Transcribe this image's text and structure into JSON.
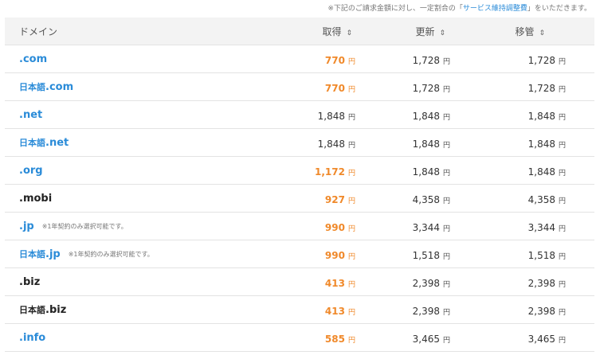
{
  "notice": {
    "before": "※下記のご請求金額に対し、一定割合の「",
    "link": "サービス維持調整費",
    "after": "」をいただきます。"
  },
  "header": {
    "domain": "ドメイン",
    "acquire": "取得",
    "renew": "更新",
    "transfer": "移管",
    "sort_icon": "⇕"
  },
  "currency": "円",
  "rows": [
    {
      "jp": "",
      "ext": ".com",
      "note": "",
      "color": "blue",
      "acquire": "770",
      "acquire_highlight": true,
      "renew": "1,728",
      "transfer": "1,728"
    },
    {
      "jp": "日本語",
      "ext": ".com",
      "note": "",
      "color": "blue",
      "acquire": "770",
      "acquire_highlight": true,
      "renew": "1,728",
      "transfer": "1,728"
    },
    {
      "jp": "",
      "ext": ".net",
      "note": "",
      "color": "blue",
      "acquire": "1,848",
      "acquire_highlight": false,
      "renew": "1,848",
      "transfer": "1,848"
    },
    {
      "jp": "日本語",
      "ext": ".net",
      "note": "",
      "color": "blue",
      "acquire": "1,848",
      "acquire_highlight": false,
      "renew": "1,848",
      "transfer": "1,848"
    },
    {
      "jp": "",
      "ext": ".org",
      "note": "",
      "color": "blue",
      "acquire": "1,172",
      "acquire_highlight": true,
      "renew": "1,848",
      "transfer": "1,848"
    },
    {
      "jp": "",
      "ext": ".mobi",
      "note": "",
      "color": "black",
      "acquire": "927",
      "acquire_highlight": true,
      "renew": "4,358",
      "transfer": "4,358"
    },
    {
      "jp": "",
      "ext": ".jp",
      "note": "※1年契約のみ選択可能です。",
      "color": "blue",
      "acquire": "990",
      "acquire_highlight": true,
      "renew": "3,344",
      "transfer": "3,344"
    },
    {
      "jp": "日本語",
      "ext": ".jp",
      "note": "※1年契約のみ選択可能です。",
      "color": "blue",
      "acquire": "990",
      "acquire_highlight": true,
      "renew": "1,518",
      "transfer": "1,518"
    },
    {
      "jp": "",
      "ext": ".biz",
      "note": "",
      "color": "black",
      "acquire": "413",
      "acquire_highlight": true,
      "renew": "2,398",
      "transfer": "2,398"
    },
    {
      "jp": "日本語",
      "ext": ".biz",
      "note": "",
      "color": "black",
      "acquire": "413",
      "acquire_highlight": true,
      "renew": "2,398",
      "transfer": "2,398"
    },
    {
      "jp": "",
      "ext": ".info",
      "note": "",
      "color": "blue",
      "acquire": "585",
      "acquire_highlight": true,
      "renew": "3,465",
      "transfer": "3,465"
    }
  ],
  "colors": {
    "link_blue": "#2a8bd8",
    "price_orange": "#f0892a",
    "header_bg": "#f3f3f3"
  }
}
